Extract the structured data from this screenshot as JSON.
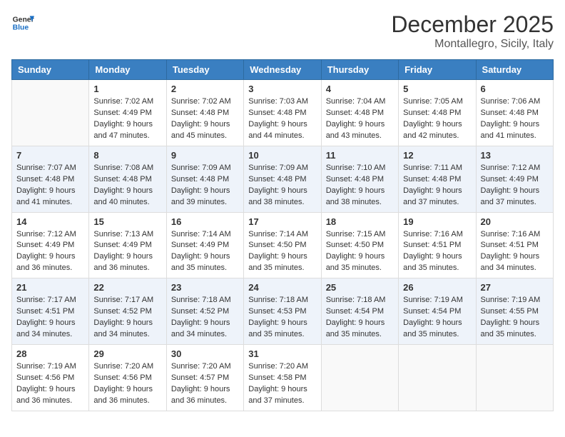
{
  "header": {
    "logo_line1": "General",
    "logo_line2": "Blue",
    "month": "December 2025",
    "location": "Montallegro, Sicily, Italy"
  },
  "days_of_week": [
    "Sunday",
    "Monday",
    "Tuesday",
    "Wednesday",
    "Thursday",
    "Friday",
    "Saturday"
  ],
  "weeks": [
    [
      {
        "day": "",
        "sunrise": "",
        "sunset": "",
        "daylight": ""
      },
      {
        "day": "1",
        "sunrise": "Sunrise: 7:02 AM",
        "sunset": "Sunset: 4:49 PM",
        "daylight": "Daylight: 9 hours and 47 minutes."
      },
      {
        "day": "2",
        "sunrise": "Sunrise: 7:02 AM",
        "sunset": "Sunset: 4:48 PM",
        "daylight": "Daylight: 9 hours and 45 minutes."
      },
      {
        "day": "3",
        "sunrise": "Sunrise: 7:03 AM",
        "sunset": "Sunset: 4:48 PM",
        "daylight": "Daylight: 9 hours and 44 minutes."
      },
      {
        "day": "4",
        "sunrise": "Sunrise: 7:04 AM",
        "sunset": "Sunset: 4:48 PM",
        "daylight": "Daylight: 9 hours and 43 minutes."
      },
      {
        "day": "5",
        "sunrise": "Sunrise: 7:05 AM",
        "sunset": "Sunset: 4:48 PM",
        "daylight": "Daylight: 9 hours and 42 minutes."
      },
      {
        "day": "6",
        "sunrise": "Sunrise: 7:06 AM",
        "sunset": "Sunset: 4:48 PM",
        "daylight": "Daylight: 9 hours and 41 minutes."
      }
    ],
    [
      {
        "day": "7",
        "sunrise": "Sunrise: 7:07 AM",
        "sunset": "Sunset: 4:48 PM",
        "daylight": "Daylight: 9 hours and 41 minutes."
      },
      {
        "day": "8",
        "sunrise": "Sunrise: 7:08 AM",
        "sunset": "Sunset: 4:48 PM",
        "daylight": "Daylight: 9 hours and 40 minutes."
      },
      {
        "day": "9",
        "sunrise": "Sunrise: 7:09 AM",
        "sunset": "Sunset: 4:48 PM",
        "daylight": "Daylight: 9 hours and 39 minutes."
      },
      {
        "day": "10",
        "sunrise": "Sunrise: 7:09 AM",
        "sunset": "Sunset: 4:48 PM",
        "daylight": "Daylight: 9 hours and 38 minutes."
      },
      {
        "day": "11",
        "sunrise": "Sunrise: 7:10 AM",
        "sunset": "Sunset: 4:48 PM",
        "daylight": "Daylight: 9 hours and 38 minutes."
      },
      {
        "day": "12",
        "sunrise": "Sunrise: 7:11 AM",
        "sunset": "Sunset: 4:48 PM",
        "daylight": "Daylight: 9 hours and 37 minutes."
      },
      {
        "day": "13",
        "sunrise": "Sunrise: 7:12 AM",
        "sunset": "Sunset: 4:49 PM",
        "daylight": "Daylight: 9 hours and 37 minutes."
      }
    ],
    [
      {
        "day": "14",
        "sunrise": "Sunrise: 7:12 AM",
        "sunset": "Sunset: 4:49 PM",
        "daylight": "Daylight: 9 hours and 36 minutes."
      },
      {
        "day": "15",
        "sunrise": "Sunrise: 7:13 AM",
        "sunset": "Sunset: 4:49 PM",
        "daylight": "Daylight: 9 hours and 36 minutes."
      },
      {
        "day": "16",
        "sunrise": "Sunrise: 7:14 AM",
        "sunset": "Sunset: 4:49 PM",
        "daylight": "Daylight: 9 hours and 35 minutes."
      },
      {
        "day": "17",
        "sunrise": "Sunrise: 7:14 AM",
        "sunset": "Sunset: 4:50 PM",
        "daylight": "Daylight: 9 hours and 35 minutes."
      },
      {
        "day": "18",
        "sunrise": "Sunrise: 7:15 AM",
        "sunset": "Sunset: 4:50 PM",
        "daylight": "Daylight: 9 hours and 35 minutes."
      },
      {
        "day": "19",
        "sunrise": "Sunrise: 7:16 AM",
        "sunset": "Sunset: 4:51 PM",
        "daylight": "Daylight: 9 hours and 35 minutes."
      },
      {
        "day": "20",
        "sunrise": "Sunrise: 7:16 AM",
        "sunset": "Sunset: 4:51 PM",
        "daylight": "Daylight: 9 hours and 34 minutes."
      }
    ],
    [
      {
        "day": "21",
        "sunrise": "Sunrise: 7:17 AM",
        "sunset": "Sunset: 4:51 PM",
        "daylight": "Daylight: 9 hours and 34 minutes."
      },
      {
        "day": "22",
        "sunrise": "Sunrise: 7:17 AM",
        "sunset": "Sunset: 4:52 PM",
        "daylight": "Daylight: 9 hours and 34 minutes."
      },
      {
        "day": "23",
        "sunrise": "Sunrise: 7:18 AM",
        "sunset": "Sunset: 4:52 PM",
        "daylight": "Daylight: 9 hours and 34 minutes."
      },
      {
        "day": "24",
        "sunrise": "Sunrise: 7:18 AM",
        "sunset": "Sunset: 4:53 PM",
        "daylight": "Daylight: 9 hours and 35 minutes."
      },
      {
        "day": "25",
        "sunrise": "Sunrise: 7:18 AM",
        "sunset": "Sunset: 4:54 PM",
        "daylight": "Daylight: 9 hours and 35 minutes."
      },
      {
        "day": "26",
        "sunrise": "Sunrise: 7:19 AM",
        "sunset": "Sunset: 4:54 PM",
        "daylight": "Daylight: 9 hours and 35 minutes."
      },
      {
        "day": "27",
        "sunrise": "Sunrise: 7:19 AM",
        "sunset": "Sunset: 4:55 PM",
        "daylight": "Daylight: 9 hours and 35 minutes."
      }
    ],
    [
      {
        "day": "28",
        "sunrise": "Sunrise: 7:19 AM",
        "sunset": "Sunset: 4:56 PM",
        "daylight": "Daylight: 9 hours and 36 minutes."
      },
      {
        "day": "29",
        "sunrise": "Sunrise: 7:20 AM",
        "sunset": "Sunset: 4:56 PM",
        "daylight": "Daylight: 9 hours and 36 minutes."
      },
      {
        "day": "30",
        "sunrise": "Sunrise: 7:20 AM",
        "sunset": "Sunset: 4:57 PM",
        "daylight": "Daylight: 9 hours and 36 minutes."
      },
      {
        "day": "31",
        "sunrise": "Sunrise: 7:20 AM",
        "sunset": "Sunset: 4:58 PM",
        "daylight": "Daylight: 9 hours and 37 minutes."
      },
      {
        "day": "",
        "sunrise": "",
        "sunset": "",
        "daylight": ""
      },
      {
        "day": "",
        "sunrise": "",
        "sunset": "",
        "daylight": ""
      },
      {
        "day": "",
        "sunrise": "",
        "sunset": "",
        "daylight": ""
      }
    ]
  ]
}
